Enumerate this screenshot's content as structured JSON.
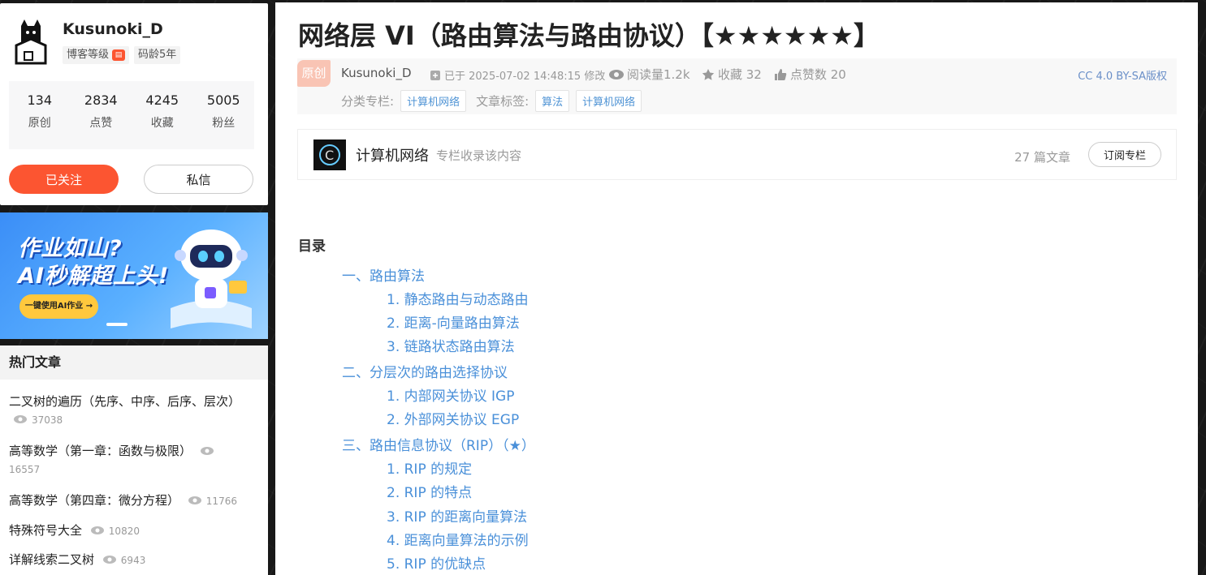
{
  "profile": {
    "username": "Kusunoki_D",
    "tags": [
      "博客等级",
      "码龄5年"
    ],
    "stats": [
      {
        "value": "134",
        "label": "原创"
      },
      {
        "value": "2834",
        "label": "点赞"
      },
      {
        "value": "4245",
        "label": "收藏"
      },
      {
        "value": "5005",
        "label": "粉丝"
      }
    ],
    "follow_label": "已关注",
    "message_label": "私信"
  },
  "banner": {
    "line1": "作业如山?",
    "line2": "AI秒解超上头!",
    "button_label": "一键使用AI作业 →"
  },
  "hot": {
    "header": "热门文章",
    "items": [
      {
        "title": "二叉树的遍历（先序、中序、后序、层次）",
        "views": "37038"
      },
      {
        "title": "高等数学（第一章：函数与极限）",
        "views": "16557"
      },
      {
        "title": "高等数学（第四章：微分方程）",
        "views": "11766"
      },
      {
        "title": "特殊符号大全",
        "views": "10820"
      },
      {
        "title": "详解线索二叉树",
        "views": "6943"
      }
    ]
  },
  "article": {
    "title": "网络层 VI（路由算法与路由协议）【★★★★★★】",
    "original_badge": "原创",
    "author": "Kusunoki_D",
    "time": "已于 2025-07-02 14:48:15 修改",
    "reads": "阅读量1.2k",
    "favorites": "收藏 32",
    "likes": "点赞数 20",
    "license": "CC 4.0 BY-SA版权",
    "category_label": "分类专栏:",
    "category": "计算机网络",
    "tags_label": "文章标签:",
    "tags": [
      "算法",
      "计算机网络"
    ]
  },
  "column": {
    "name": "计算机网络",
    "subtitle": "专栏收录该内容",
    "count": "27 篇文章",
    "subscribe_label": "订阅专栏"
  },
  "toc": {
    "title": "目录",
    "items": [
      {
        "level": 1,
        "text": "一、路由算法"
      },
      {
        "level": 2,
        "text": "1. 静态路由与动态路由"
      },
      {
        "level": 2,
        "text": "2. 距离-向量路由算法"
      },
      {
        "level": 2,
        "text": "3. 链路状态路由算法"
      },
      {
        "level": 1,
        "text": "二、分层次的路由选择协议"
      },
      {
        "level": 2,
        "text": "1. 内部网关协议 IGP"
      },
      {
        "level": 2,
        "text": "2. 外部网关协议 EGP"
      },
      {
        "level": 1,
        "text": "三、路由信息协议（RIP）（★）"
      },
      {
        "level": 2,
        "text": "1. RIP 的规定"
      },
      {
        "level": 2,
        "text": "2. RIP 的特点"
      },
      {
        "level": 2,
        "text": "3. RIP 的距离向量算法"
      },
      {
        "level": 2,
        "text": "4. 距离向量算法的示例"
      },
      {
        "level": 2,
        "text": "5. RIP 的优缺点"
      }
    ]
  },
  "colors": {
    "accent": "#fc5531",
    "link": "#4a90d9",
    "chip_text": "#5094d5"
  }
}
